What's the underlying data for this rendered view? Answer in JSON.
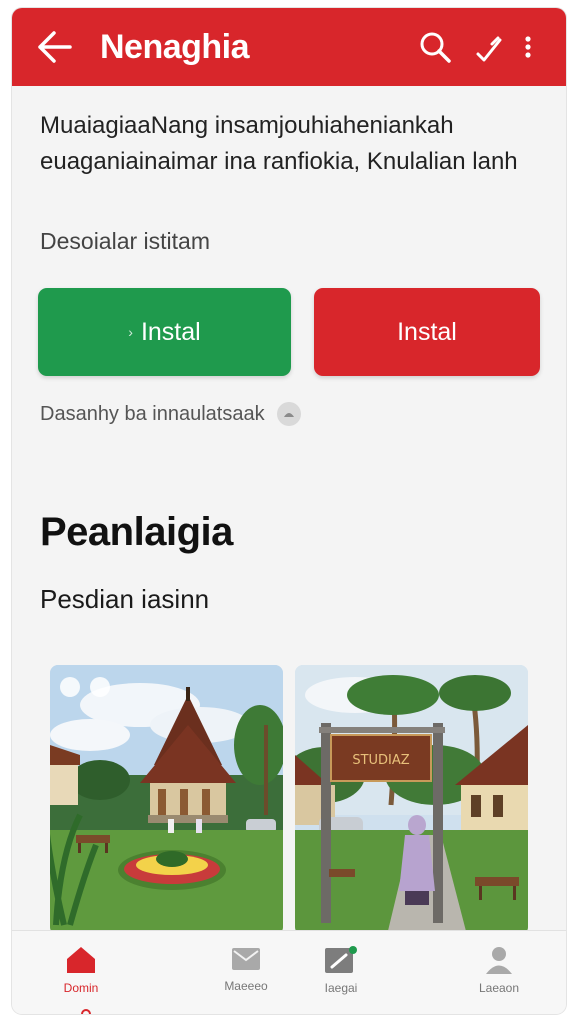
{
  "appbar": {
    "title": "Nenaghia",
    "color": "#d8262b",
    "icons": [
      "back-arrow-icon",
      "search-icon",
      "edit-icon",
      "more-vert-icon"
    ]
  },
  "intro": {
    "text": "MuaiagiaaNang insamjouhiaheniankah euaganiainaimar ina ranfiokia, Knulalian lanh"
  },
  "subtitle": "Desoialar istitam",
  "buttons": {
    "primary_label": "Instal",
    "secondary_label": "Instal",
    "primary_color": "#1f9a4d",
    "secondary_color": "#d8262b"
  },
  "note": {
    "text": "Dasanhy ba innaulatsaak"
  },
  "section": {
    "title": "Peanlaigia",
    "subtitle": "Pesdian iasinn"
  },
  "gallery": {
    "sign_text": "STUDIAZ"
  },
  "bottomnav": {
    "items": [
      {
        "label": "Domin",
        "icon": "home-icon",
        "active": true
      },
      {
        "label": "Maeeeo",
        "icon": "mail-icon",
        "active": false
      },
      {
        "label": "Iaegai",
        "icon": "edit-badge-icon",
        "active": false
      },
      {
        "label": "Laeaon",
        "icon": "person-icon",
        "active": false
      }
    ]
  }
}
